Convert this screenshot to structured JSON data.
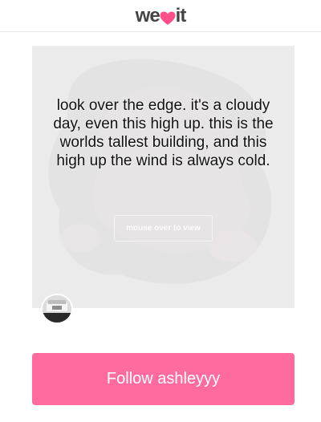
{
  "header": {
    "logo_prefix": "we",
    "logo_suffix": "it"
  },
  "post": {
    "quote": "look over the edge. it's a cloudy day, even this high up. this is the worlds tallest building, and this high up the wind is always cold.",
    "mouse_over_label": "mouse over to view"
  },
  "follow": {
    "label": "Follow ashleyyy"
  },
  "colors": {
    "brand_pink": "#ff6b9e",
    "card_bg": "#ebebeb",
    "header_border": "#e6e6e6"
  }
}
